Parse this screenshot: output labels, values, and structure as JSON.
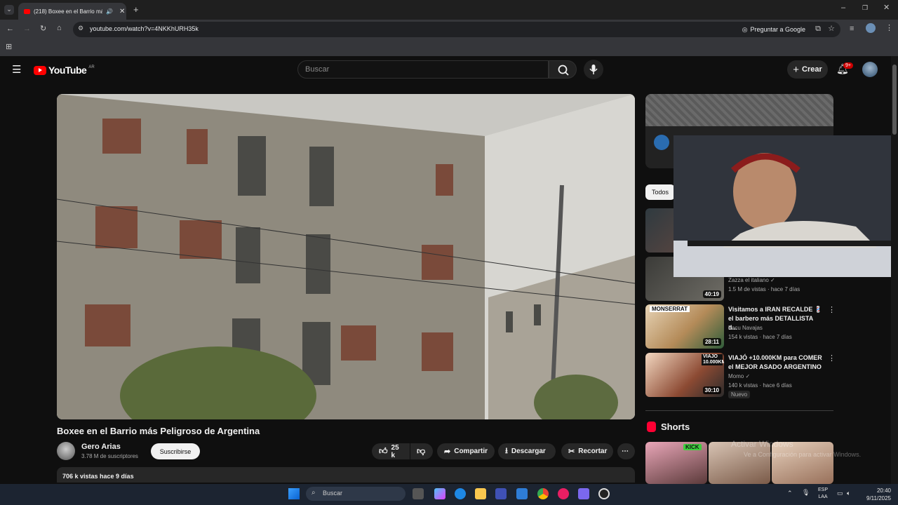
{
  "browser": {
    "tab_title": "(218) Boxee en el Barrio más",
    "url": "youtube.com/watch?v=4NKKhURH35k",
    "google_button": "Preguntar a Google"
  },
  "header": {
    "logo_text": "YouTube",
    "country": "AR",
    "search_placeholder": "Buscar",
    "create_label": "Crear",
    "notifications_badge": "9+"
  },
  "video": {
    "title": "Boxee en el Barrio más Peligroso de Argentina",
    "channel": "Gero Arias",
    "subscribers": "3.78 M de suscriptores",
    "subscribe_label": "Suscribirse",
    "likes": "25 k",
    "share_label": "Compartir",
    "download_label": "Descargar",
    "clip_label": "Recortar",
    "views_date": "706 k vistas  hace 9 días"
  },
  "sidebar": {
    "filter_chip": "Todos",
    "recommendations": [
      {
        "title": "",
        "channel": "Zazza el italiano",
        "meta": "1.5 M de vistas · hace 7 días",
        "duration": "40:19",
        "verified": true
      },
      {
        "title": "Visitamos a IRAN RECALDE 💈 el barbero más DETALLISTA d...",
        "channel": "Facu Navajas",
        "meta": "154 k vistas · hace 7 días",
        "duration": "28:11",
        "thumb_text": "MONSERRAT"
      },
      {
        "title": "VIAJÓ +10.000KM para COMER el MEJOR ASADO ARGENTINO",
        "channel": "Momo",
        "meta": "140 k vistas · hace 6 días",
        "duration": "30:10",
        "thumb_text": "VIAJO 10.000KM",
        "badge": "Nuevo",
        "verified": true
      }
    ],
    "shorts_title": "Shorts",
    "short_badge": "KICK"
  },
  "watermark": {
    "line1": "Activar Windows",
    "line2": "Ve a Configuración para activar Windows."
  },
  "taskbar": {
    "search_label": "Buscar",
    "lang_line1": "ESP",
    "lang_line2": "LAA",
    "time": "20:40",
    "date": "9/11/2025"
  },
  "colors": {
    "youtube_red": "#ff0000",
    "background": "#0f0f0f",
    "chrome_dark": "#35363a"
  }
}
